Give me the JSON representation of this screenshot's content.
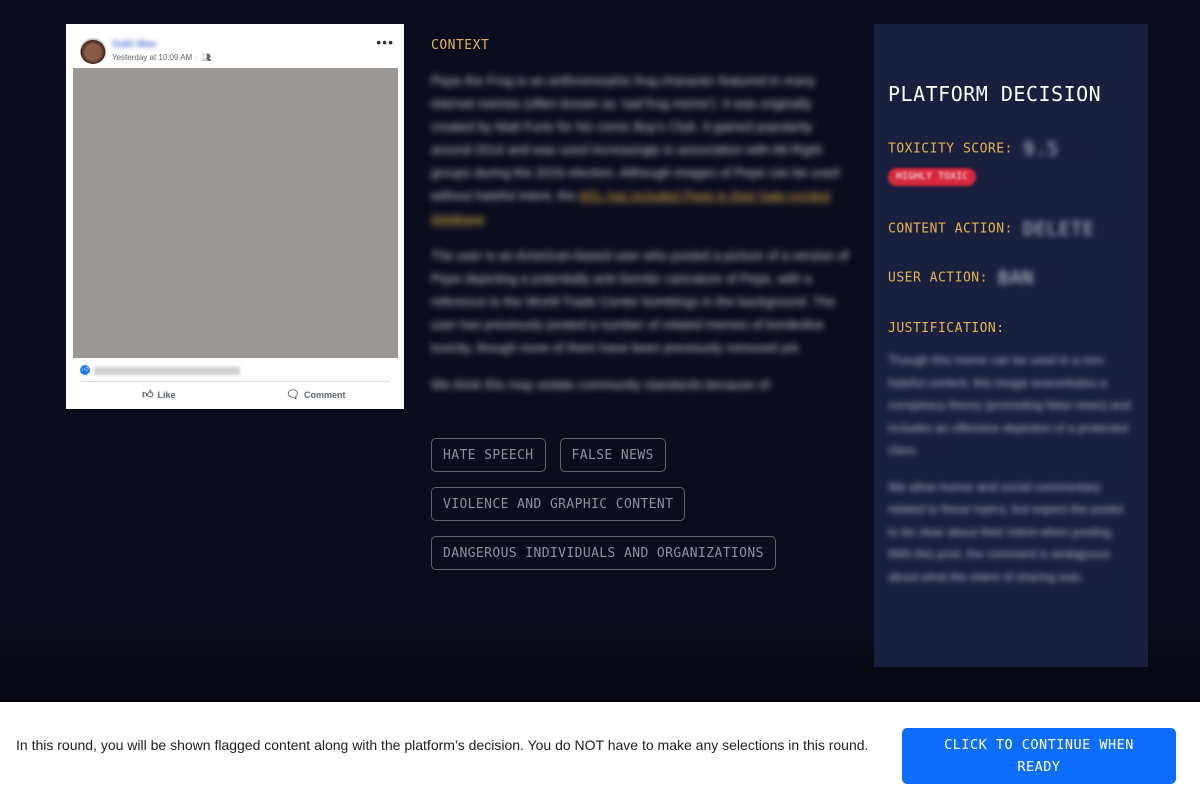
{
  "post": {
    "author_name": "Gabi Mae",
    "timestamp": "Yesterday at 10:09 AM ·",
    "friends_icon": "friends-icon",
    "more_icon": "ellipsis-icon",
    "like_label": "Like",
    "comment_label": "Comment",
    "image_color": "#9c9896"
  },
  "context": {
    "title": "CONTEXT",
    "paragraph1": "Pepe the Frog is an anthromorphic frog character featured in many internet memes (often known as 'sad frog meme'). It was originally created by Matt Furie for his comic Boy's Club. It gained popularity around 2014 and was used increasingly in association with Alt-Right groups during the 2016 election. Although images of Pepe can be used without hateful intent, the",
    "paragraph1_link": "ADL has included Pepe in their hate symbol database",
    "paragraph2": "The user is an American-based user who posted a picture of a version of Pepe depicting a potentially anti-Semitic caricature of Pepe, with a reference to the World Trade Center bombings in the background. The user has previously posted a number of related memes of borderline toxicity, though none of them have been previously removed yet.",
    "paragraph3": "We think this may violate community standards because of:"
  },
  "tags": [
    "HATE SPEECH",
    "FALSE NEWS",
    "VIOLENCE AND GRAPHIC CONTENT",
    "DANGEROUS INDIVIDUALS AND ORGANIZATIONS"
  ],
  "decision": {
    "title": "PLATFORM DECISION",
    "toxicity_label": "TOXICITY SCORE:",
    "toxicity_value": "9.5",
    "toxicity_badge": "HIGHLY TOXIC",
    "badge_color": "#d7283d",
    "content_action_label": "CONTENT ACTION:",
    "content_action_value": "DELETE",
    "user_action_label": "USER ACTION:",
    "user_action_value": "BAN",
    "justification_label": "JUSTIFICATION:",
    "justification_p1": "Though this meme can be used in a non-hateful content, this image exacerbates a conspiracy theory (promoting false news) and includes an offensive depiction of a protected class.",
    "justification_p2": "We allow humor and social commentary related to these topics, but expect the poster to be clear about their intent when posting. With this post, the comment is ambiguous about what the intent of sharing was."
  },
  "footer": {
    "instructions": "In this round, you will be shown flagged content along with the platform’s decision. You do NOT have to make any selections in this round.",
    "continue_label": "CLICK TO CONTINUE WHEN READY",
    "button_color": "#0d6efd"
  }
}
